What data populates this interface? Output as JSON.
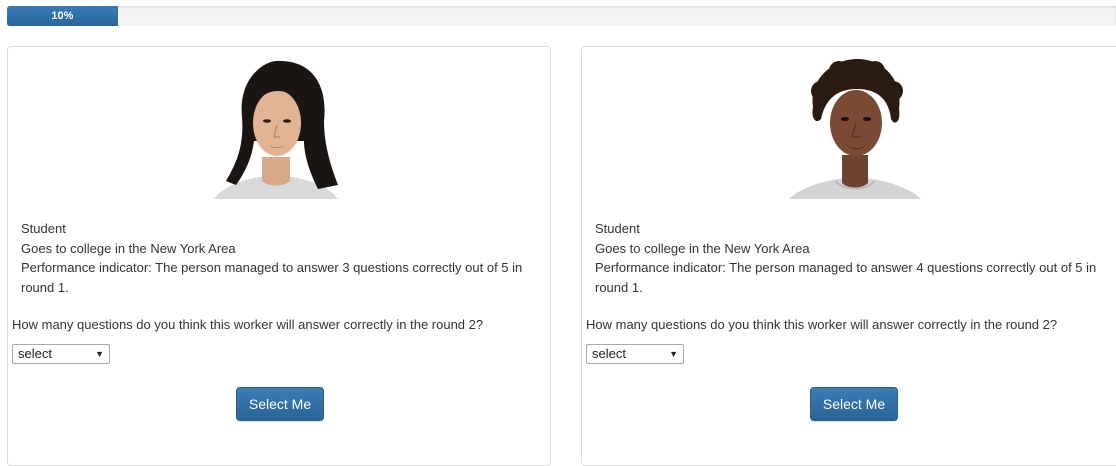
{
  "progress": {
    "label": "10%",
    "value_percent": 10,
    "color": "#2f6fa7"
  },
  "candidates": [
    {
      "photo": "portrait-photo",
      "occupation": "Student",
      "location": "Goes to college in the New York Area",
      "performance": "Performance indicator: The person managed to answer 3 questions correctly out of 5 in round 1.",
      "question": "How many questions do you think this worker will answer correctly in the round 2?",
      "select_value": "select",
      "button_label": "Select Me"
    },
    {
      "photo": "portrait-photo",
      "occupation": "Student",
      "location": "Goes to college in the New York Area",
      "performance": "Performance indicator: The person managed to answer 4 questions correctly out of 5 in round 1.",
      "question": "How many questions do you think this worker will answer correctly in the round 2?",
      "select_value": "select",
      "button_label": "Select Me"
    }
  ],
  "colors": {
    "button": "#2f6fa7",
    "card_border": "#dcdcdc"
  }
}
